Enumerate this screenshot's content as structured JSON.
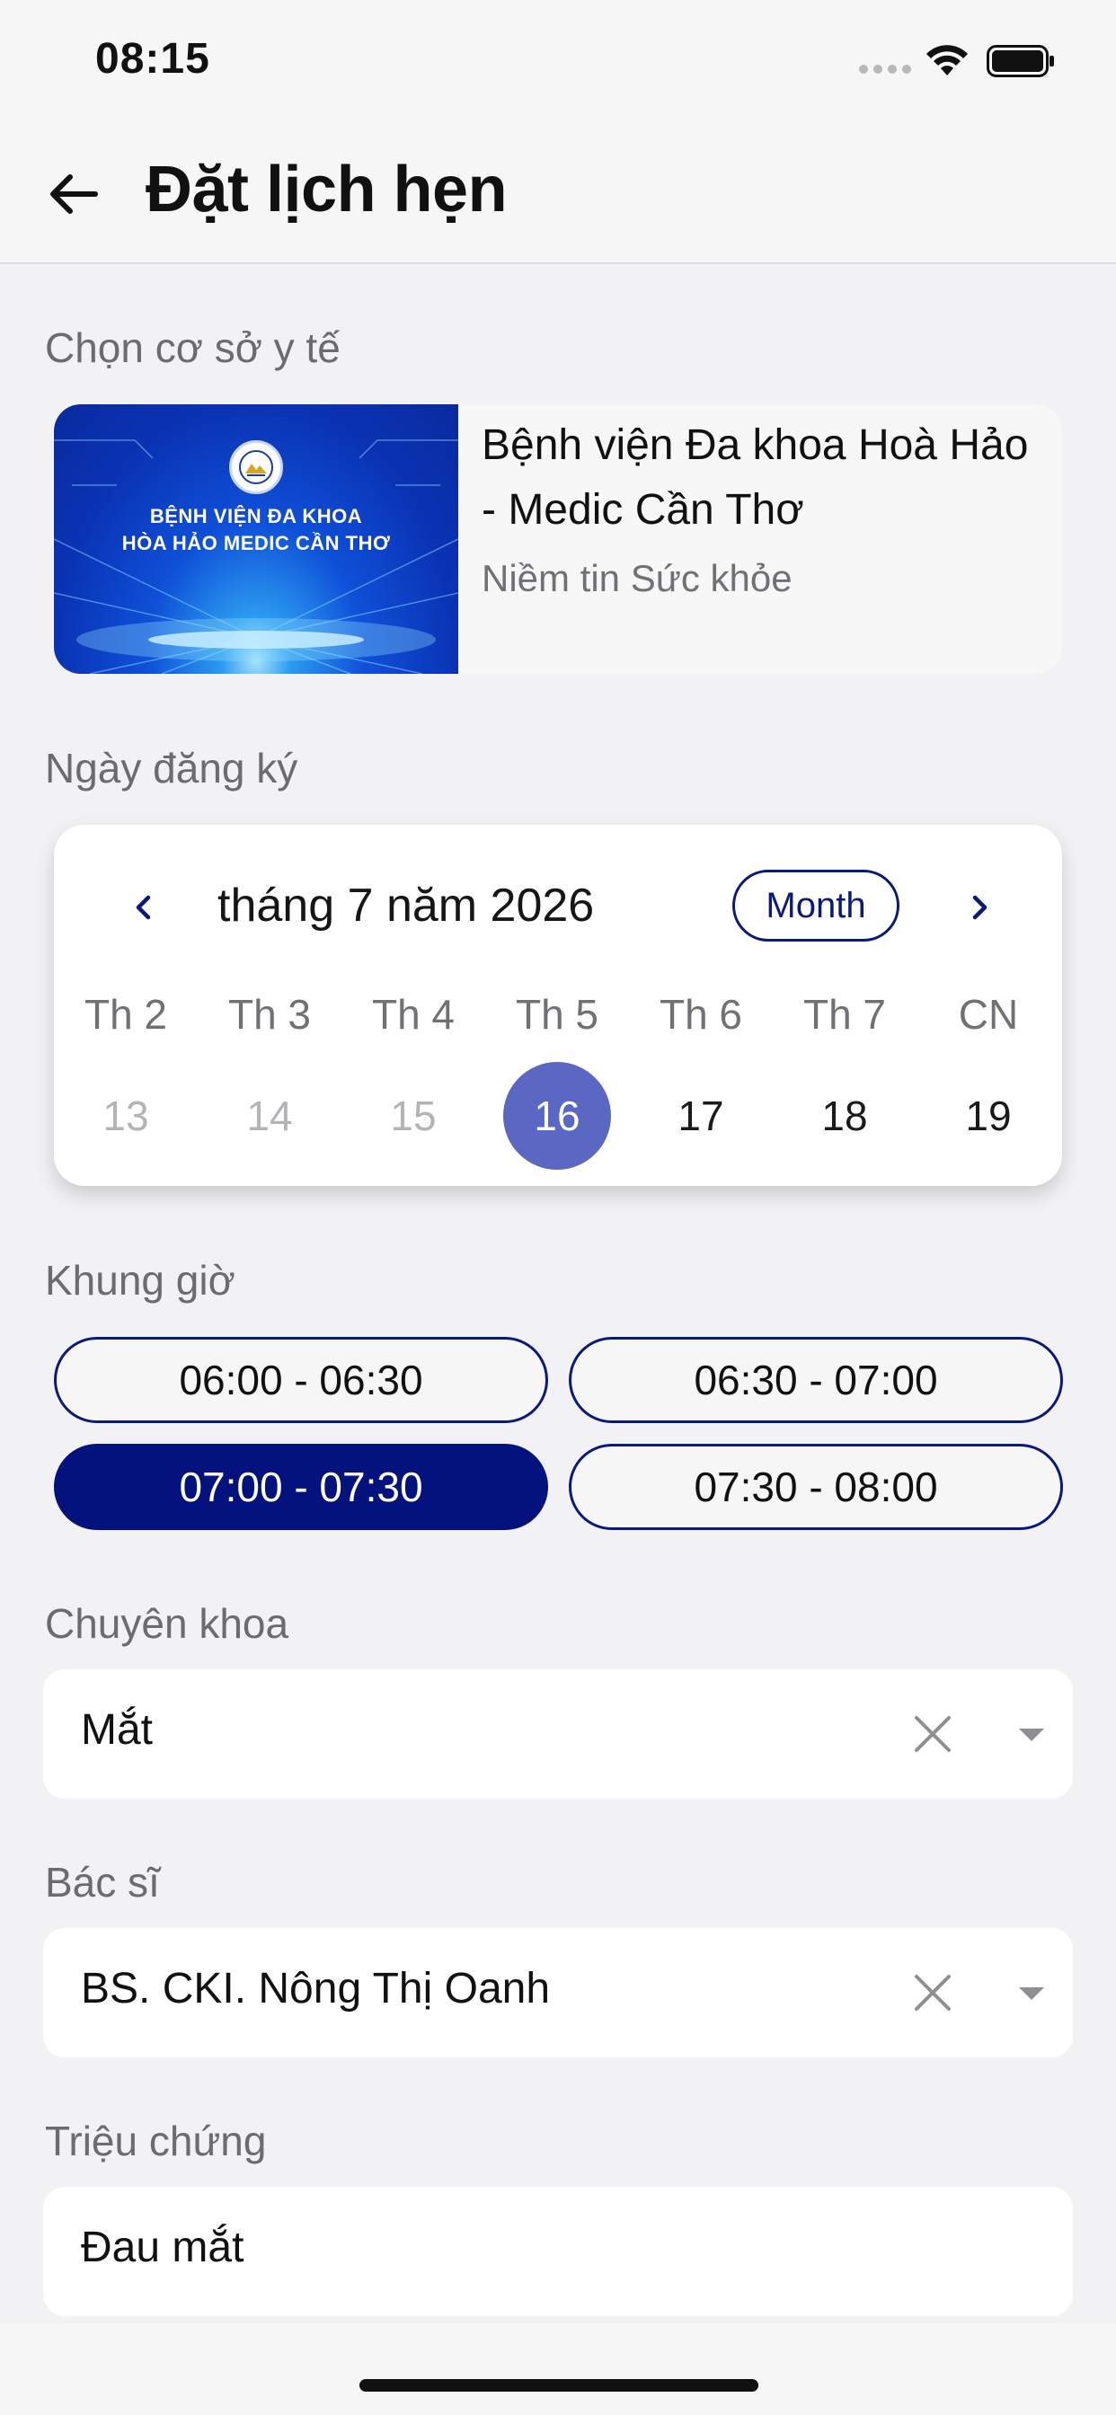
{
  "status_bar": {
    "time": "08:15"
  },
  "header": {
    "title": "Đặt lịch hẹn",
    "back_icon": "arrow-left-icon"
  },
  "facility": {
    "label": "Chọn cơ sở y tế",
    "name": "Bệnh viện Đa khoa Hoà Hảo - Medic Cần Thơ",
    "slogan": "Niềm tin Sức khỏe",
    "banner_line1": "BỆNH VIỆN ĐA KHOA",
    "banner_line2": "HÒA HẢO MEDIC CẦN THƠ"
  },
  "calendar": {
    "label": "Ngày đăng ký",
    "title": "tháng 7 năm 2026",
    "format_button": "Month",
    "weekdays": [
      "Th 2",
      "Th 3",
      "Th 4",
      "Th 5",
      "Th 6",
      "Th 7",
      "CN"
    ],
    "days": [
      {
        "day": "13",
        "state": "past"
      },
      {
        "day": "14",
        "state": "past"
      },
      {
        "day": "15",
        "state": "past"
      },
      {
        "day": "16",
        "state": "selected"
      },
      {
        "day": "17",
        "state": "normal"
      },
      {
        "day": "18",
        "state": "normal"
      },
      {
        "day": "19",
        "state": "normal"
      }
    ]
  },
  "time_slots": {
    "label": "Khung giờ",
    "slots": [
      {
        "label": "06:00 - 06:30",
        "selected": false
      },
      {
        "label": "06:30 - 07:00",
        "selected": false
      },
      {
        "label": "07:00 - 07:30",
        "selected": true
      },
      {
        "label": "07:30 - 08:00",
        "selected": false
      }
    ]
  },
  "specialty": {
    "label": "Chuyên khoa",
    "value": "Mắt"
  },
  "doctor": {
    "label": "Bác sĩ",
    "value": "BS. CKI. Nông Thị Oanh"
  },
  "symptoms": {
    "label": "Triệu chứng",
    "value": "Đau mắt"
  },
  "colors": {
    "primary": "#04127e",
    "selected_day": "#5a68c4",
    "background": "#f2f2f4"
  }
}
